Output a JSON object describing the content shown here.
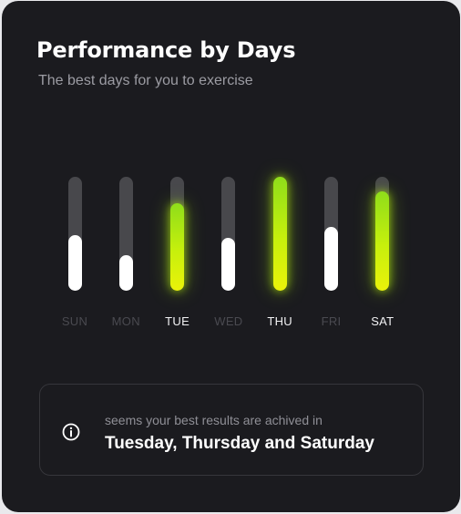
{
  "header": {
    "title": "Performance by Days",
    "subtitle": "The best days for you to exercise"
  },
  "chart_data": {
    "type": "bar",
    "categories": [
      "SUN",
      "MON",
      "TUE",
      "WED",
      "THU",
      "FRI",
      "SAT"
    ],
    "values": [
      0.49,
      0.31,
      0.77,
      0.46,
      1.0,
      0.56,
      0.87
    ],
    "highlighted": [
      "TUE",
      "THU",
      "SAT"
    ],
    "ylim": [
      0,
      1
    ],
    "grid": false,
    "colors": {
      "track": "#48484c",
      "fill": "#ffffff",
      "highlight": "#c7f00c",
      "label_active": "#f2f2f4",
      "label_inactive": "#4a4a50"
    }
  },
  "summary": {
    "icon": "info-circle-icon",
    "caption": "seems your best results are achived in",
    "days": "Tuesday, Thursday and Saturday"
  },
  "colors": {
    "card_background": "#1b1b1f",
    "accent": "#c7f00c"
  }
}
